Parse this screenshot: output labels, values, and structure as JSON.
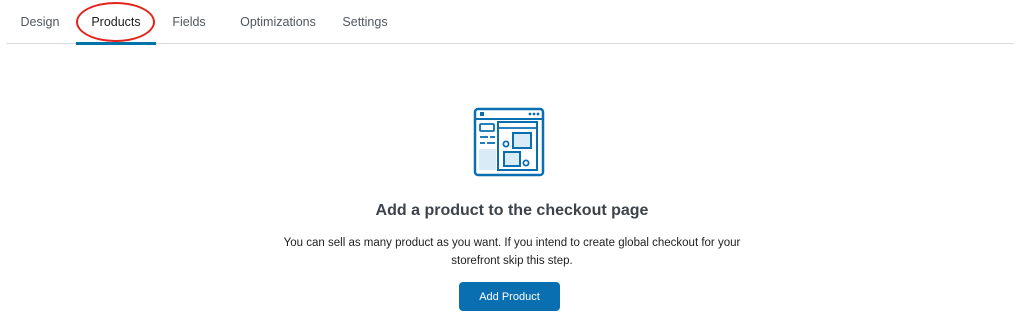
{
  "tabs": {
    "design": "Design",
    "products": "Products",
    "fields": "Fields",
    "optimizations": "Optimizations",
    "settings": "Settings",
    "active": "products"
  },
  "empty_state": {
    "illustration_icon": "checkout-page-illustration-icon",
    "title": "Add a product to the checkout page",
    "description": "You can sell as many product as you want. If you intend to create global checkout for your storefront skip this step.",
    "button_label": "Add Product"
  },
  "colors": {
    "accent": "#0073aa",
    "button": "#0a6fb0",
    "highlight_ring": "#e2241b",
    "illustration_stroke": "#0a6fb0",
    "illustration_fill": "#d9ebf7"
  }
}
